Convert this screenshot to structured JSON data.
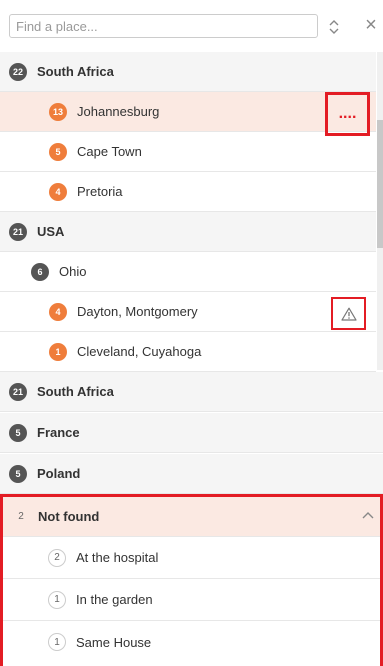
{
  "search": {
    "placeholder": "Find a place..."
  },
  "toolbar": {
    "sort_icon": "sort-icon",
    "close_glyph": "×"
  },
  "groups": [
    {
      "count": "22",
      "label": "South Africa"
    },
    {
      "count": "21",
      "label": "USA"
    },
    {
      "count": "21",
      "label": "South Africa"
    },
    {
      "count": "5",
      "label": "France"
    },
    {
      "count": "5",
      "label": "Poland"
    }
  ],
  "cities": [
    {
      "count": "13",
      "label": "Johannesburg"
    },
    {
      "count": "5",
      "label": "Cape Town"
    },
    {
      "count": "4",
      "label": "Pretoria"
    }
  ],
  "usa": {
    "state": {
      "count": "6",
      "label": "Ohio"
    },
    "cities": [
      {
        "count": "4",
        "label": "Dayton, Montgomery"
      },
      {
        "count": "1",
        "label": "Cleveland, Cuyahoga"
      }
    ]
  },
  "not_found": {
    "count": "2",
    "label": "Not found",
    "items": [
      {
        "count": "2",
        "label": "At the hospital"
      },
      {
        "count": "1",
        "label": "In the garden"
      },
      {
        "count": "1",
        "label": "Same House"
      }
    ]
  },
  "actions": {
    "menu_dots": "....",
    "warning_icon": "warning-icon"
  },
  "colors": {
    "accent": "#ef7d3b",
    "highlight": "#e31c24",
    "selected_bg": "#fbe9e2",
    "header_bg": "#f5f5f5"
  }
}
